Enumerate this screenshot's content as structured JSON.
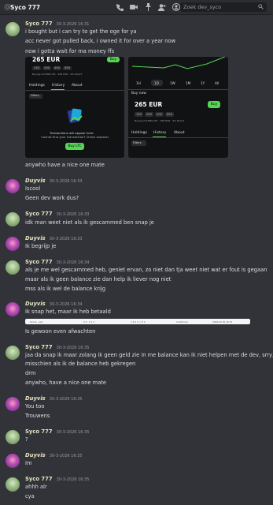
{
  "channel": {
    "title": "Syco 777"
  },
  "search": {
    "placeholder": "Zoek dev_syco"
  },
  "icons": [
    "call-icon",
    "video-icon",
    "pin-icon",
    "add-friend-icon",
    "profile-icon",
    "search-icon"
  ],
  "colors": {
    "background": "#313338",
    "accent_green": "#55d655",
    "username": "#e6e3c0"
  },
  "messages": [
    {
      "author": "Syco 777",
      "time": "30-3-2026 16:31",
      "lines": [
        "i bought but i can try to get the oge for ya",
        "acc never got pulled back, i owned it for over a year now",
        "now i gotta wait for ma money ffs"
      ]
    },
    {
      "lines": [
        "anywho have a nice one mate"
      ]
    },
    {
      "author": "Duyvis",
      "time": "30-3-2026 16:33",
      "lines": [
        "Iscool",
        "Geen dev work dus?"
      ]
    },
    {
      "author": "Syco 777",
      "time": "30-3-2026 16:33",
      "lines": [
        "idk man weet niet als ik gescammed ben snap je"
      ]
    },
    {
      "author": "Duyvis",
      "time": "30-3-2026 16:33",
      "lines": [
        "Ik begrijp je"
      ]
    },
    {
      "author": "Syco 777",
      "time": "30-3-2026 16:34",
      "lines": [
        "als je me wel gescammed heb, geniet ervan, zo niet dan tja weet niet wat er fout is gegaan",
        "maar als ik geen balance zie dan help ik liever nog niet",
        "mss als ik wel de balance krijg"
      ]
    },
    {
      "author": "Duyvis",
      "time": "30-3-2026 16:34",
      "lines": [
        "Ik snap het, maar ik heb betaald",
        "Is gewoon even afwachten"
      ]
    },
    {
      "author": "Syco 777",
      "time": "30-3-2026 16:35",
      "lines": [
        "jaa da snap ik maar zolang ik geen geld zie in me balance kan ik niet helpen met de dev, srry,",
        "misschien als ik de balance heb gekregen",
        "drm",
        "anywho, have a nice one mate"
      ]
    },
    {
      "author": "Duyvis",
      "time": "30-3-2026 16:35",
      "lines": [
        "You too",
        "Trouwens"
      ]
    },
    {
      "author": "Syco 777",
      "time": "30-3-2026 16:35",
      "lines": [
        "?"
      ]
    },
    {
      "author": "Duyvis",
      "time": "30-3-2026 16:35",
      "lines": [
        "Im"
      ]
    },
    {
      "author": "Syco 777",
      "time": "30-3-2026 16:35",
      "lines": [
        "ahhh alr",
        "cya"
      ]
    }
  ],
  "screenshot_left": {
    "balance": "265 EUR",
    "buy_label": "Buy",
    "amounts": [
      "150",
      "200",
      "400",
      "850"
    ],
    "note": "Buying 0.07862 LTC · 265 EUR · 4% Direct",
    "tabs": [
      "Holdings",
      "History",
      "About"
    ],
    "filter": "Filters",
    "empty_title": "Transactions will appear here.",
    "empty_sub": "Cannot find your transaction? Check explorer",
    "cta": "Buy LTC"
  },
  "screenshot_right": {
    "ranges": [
      "1H",
      "1D",
      "1W",
      "1M",
      "1Y",
      "All"
    ],
    "buy_now": "Buy now",
    "balance": "265 EUR",
    "buy_label": "Buy",
    "amounts": [
      "150",
      "200",
      "400",
      "850"
    ],
    "note": "Buying 0.07862 LTC · 265 EUR · 4% Direct",
    "tabs": [
      "Holdings",
      "History",
      "About"
    ],
    "filter": "Filters"
  },
  "transaction_strip": {
    "cells": [
      "0x1c2...ae3",
      "3 3 · 0 1 3",
      "n 0 4 3...f 7 b",
      "Confirmed",
      "2026-03-30 16:33"
    ]
  }
}
